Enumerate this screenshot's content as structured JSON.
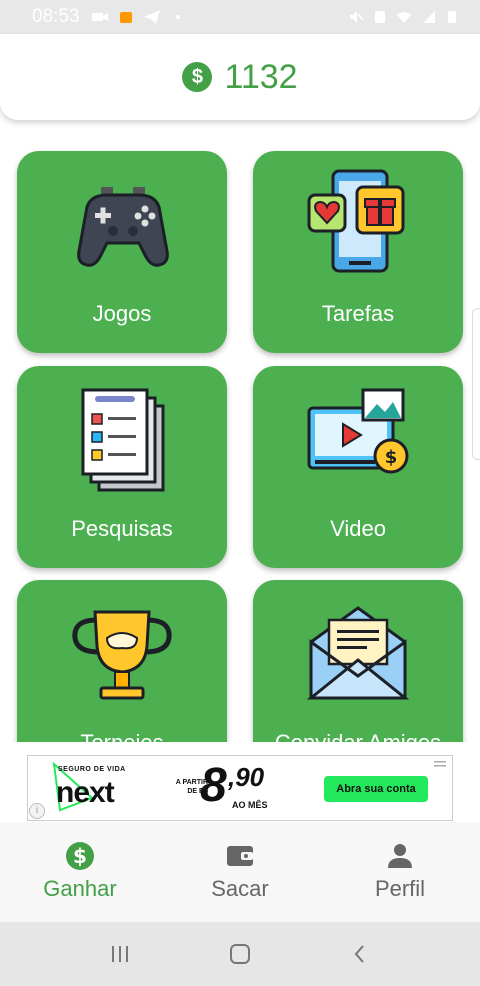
{
  "status_bar": {
    "time": "08:53"
  },
  "header": {
    "balance": "1132"
  },
  "cards": [
    {
      "label": "Jogos",
      "icon": "gamepad-icon"
    },
    {
      "label": "Tarefas",
      "icon": "phone-gift-icon"
    },
    {
      "label": "Pesquisas",
      "icon": "survey-icon"
    },
    {
      "label": "Video",
      "icon": "video-coin-icon"
    },
    {
      "label": "Torneios",
      "icon": "trophy-icon"
    },
    {
      "label": "Convidar Amigos",
      "icon": "envelope-icon"
    }
  ],
  "ad": {
    "small_top": "SEGURO DE VIDA",
    "brand": "next",
    "prefix": "A PARTIR DE R$",
    "price": "8",
    "price_decimal": ",90",
    "per_month": "AO MÊS",
    "cta": "Abra sua conta",
    "info": "i"
  },
  "bottom_nav": [
    {
      "label": "Ganhar",
      "icon": "dollar-coin-icon",
      "active": true
    },
    {
      "label": "Sacar",
      "icon": "wallet-icon",
      "active": false
    },
    {
      "label": "Perfil",
      "icon": "person-icon",
      "active": false
    }
  ],
  "colors": {
    "primary": "#4caf50",
    "accent_text": "#43a047",
    "nav_inactive": "#666666"
  }
}
